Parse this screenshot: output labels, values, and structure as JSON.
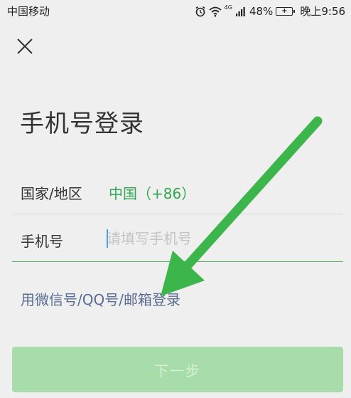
{
  "status_bar": {
    "carrier": "中国移动",
    "network": "4G",
    "battery_percent": "48%",
    "time": "晚上9:56",
    "icons": [
      "alarm-icon",
      "wifi-icon",
      "signal-icon",
      "battery-icon"
    ]
  },
  "header": {
    "close_icon": "close-icon"
  },
  "main": {
    "title": "手机号登录",
    "country_label": "国家/地区",
    "country_value": "中国（+86）",
    "phone_label": "手机号",
    "phone_placeholder": "请填写手机号",
    "alt_login": "用微信号/QQ号/邮箱登录",
    "next_button": "下一步"
  },
  "colors": {
    "accent": "#2fa84f",
    "link": "#5a6d94",
    "button_disabled": "#a8dcab",
    "arrow": "#3cb54a"
  }
}
